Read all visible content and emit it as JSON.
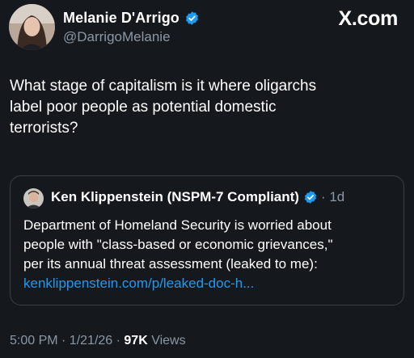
{
  "author": {
    "display_name": "Melanie D'Arrigo",
    "handle": "@DarrigoMelanie",
    "verified": true
  },
  "brand": {
    "label": "X.com"
  },
  "tweet": {
    "lines": [
      "What stage of capitalism is it where oligarchs",
      "label poor people as potential domestic",
      "terrorists?"
    ]
  },
  "quote": {
    "display_name": "Ken Klippenstein (NSPM-7 Compliant)",
    "time": "· 1d",
    "lines": [
      "Department of Homeland Security is worried about",
      "people with \"class-based or economic grievances,\"",
      "per its annual threat assessment (leaked to me):"
    ],
    "link": "kenklippenstein.com/p/leaked-doc-h..."
  },
  "meta": {
    "time": "5:00 PM · 1/21/26 · ",
    "views_count": "97K",
    "views_label": " Views"
  },
  "colors": {
    "background": "#15181d",
    "verified_badge": "#1d9bf0",
    "link": "#1d9bf0",
    "muted_text": "#8b98a5"
  }
}
